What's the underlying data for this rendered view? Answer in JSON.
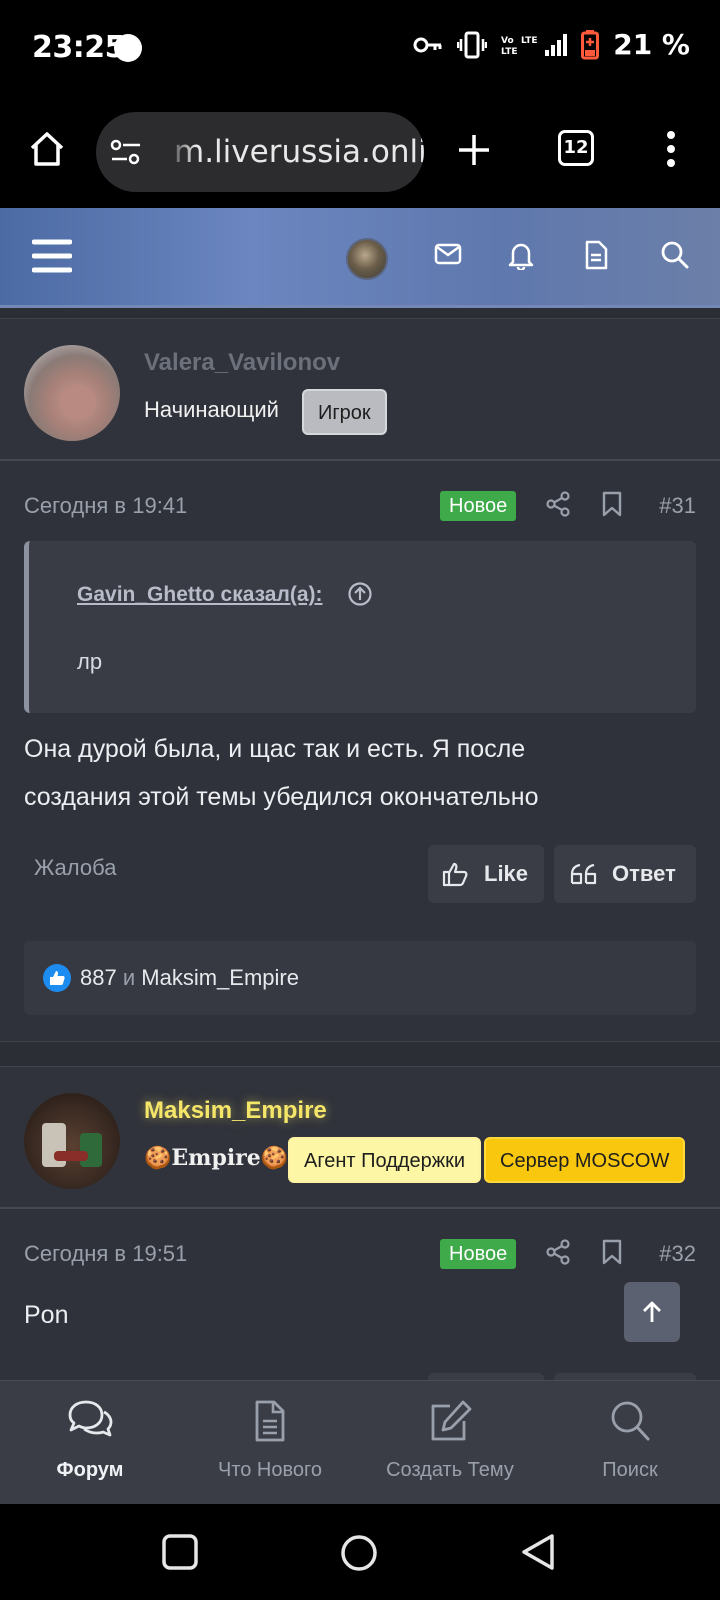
{
  "status": {
    "time": "23:25",
    "battery": "21 %"
  },
  "browser": {
    "url": "m.liverussia.online",
    "tab_count": "12"
  },
  "posts": [
    {
      "username": "Valera_Vavilonov",
      "username_color": "#6c707a",
      "rank": "Начинающий",
      "badges": [
        {
          "label": "Игрок",
          "bg": "#b9bbc0",
          "color": "#1e1e1e"
        }
      ],
      "date": "Сегодня в 19:41",
      "new_label": "Новое",
      "number": "#31",
      "quote_author": "Gavin_Ghetto сказал(а):",
      "quote_text": "лр",
      "body_line1": "Она дурой была, и щас так и есть. Я после",
      "body_line2": "создания этой темы убедился окончательно",
      "report": "Жалоба",
      "like_label": "Like",
      "reply_label": "Ответ",
      "likes_count": "887",
      "likes_and": "и",
      "likes_user": "Maksim_Empire"
    },
    {
      "username": "Maksim_Empire",
      "username_color": "#f5e66a",
      "rank": "🍪𝐄𝐦𝐩𝐢𝐫𝐞🍪",
      "badges": [
        {
          "label": "Агент Поддержки",
          "bg": "#fdf6a4",
          "color": "#1e1e1e"
        },
        {
          "label": "Сервер MOSCOW",
          "bg": "#f9c80e",
          "color": "#1e1e1e"
        }
      ],
      "date": "Сегодня в 19:51",
      "new_label": "Новое",
      "number": "#32",
      "body_line1": "Pon"
    }
  ],
  "bottom_nav": [
    {
      "label": "Форум",
      "icon": "chat-bubbles-icon",
      "active": true
    },
    {
      "label": "Что Нового",
      "icon": "document-icon",
      "active": false
    },
    {
      "label": "Создать Тему",
      "icon": "edit-icon",
      "active": false
    },
    {
      "label": "Поиск",
      "icon": "search-icon",
      "active": false
    }
  ]
}
